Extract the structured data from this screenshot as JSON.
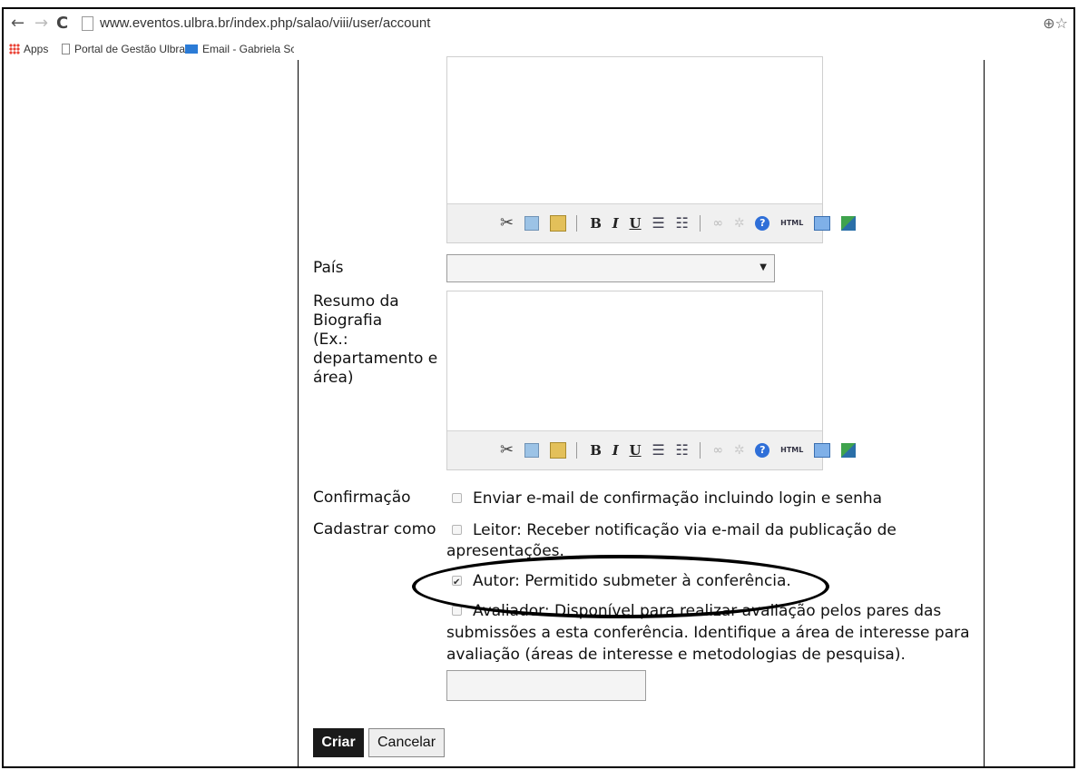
{
  "browser": {
    "url": "www.eventos.ulbra.br/index.php/salao/viii/user/account",
    "bookmarks": [
      {
        "label": "Apps"
      },
      {
        "label": "Portal de Gestão Ulbra"
      },
      {
        "label": "Email - Gabriela Schoe"
      }
    ]
  },
  "form": {
    "pais_label": "País",
    "pais_value": "",
    "bio_label_lines": [
      "Resumo da",
      "Biografia",
      "(Ex.:",
      "departamento e",
      "área)"
    ],
    "confirm_label": "Confirmação",
    "confirm_option": "Enviar e-mail de confirmação incluindo login e senha",
    "confirm_checked": false,
    "cadastrar_label": "Cadastrar como",
    "leitor_line1": "Leitor: Receber notificação via e-mail da publicação de",
    "leitor_line2": "apresentações.",
    "leitor_checked": false,
    "autor_option": "Autor: Permitido submeter à conferência.",
    "autor_checked": true,
    "avaliador_line1": "Avaliador: Disponível para realizar avaliação pelos pares das",
    "avaliador_line2": "submissões a esta conferência. Identifique a área de interesse para",
    "avaliador_line3": "avaliação (áreas de interesse e metodologias de pesquisa).",
    "avaliador_checked": false,
    "interests_value": "",
    "submit_label": "Criar",
    "cancel_label": "Cancelar"
  }
}
